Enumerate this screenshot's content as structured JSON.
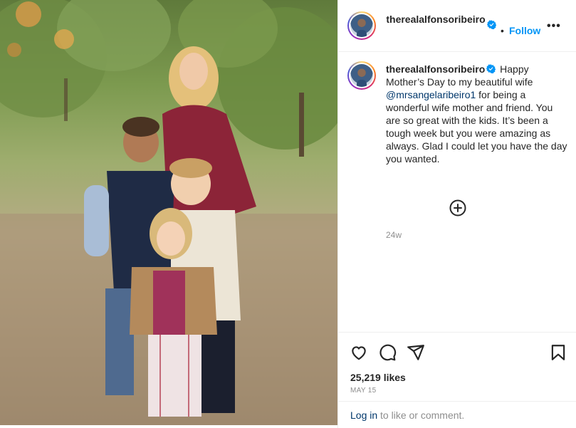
{
  "post": {
    "username": "therealalfonsoribeiro",
    "follow_label": "Follow",
    "separator": "•",
    "more_label": "•••",
    "caption_user": "therealalfonsoribeiro",
    "caption_part1": " Happy Mother’s Day to my beautiful wife ",
    "caption_mention": "@mrsangelaribeiro1",
    "caption_part2": " for being a wonderful wife mother and friend. You are so great with the kids. It’s been a tough week but you were amazing as always. Glad I could let you have the day you wanted.",
    "time_ago": "24w",
    "likes": "25,219 likes",
    "date": "MAY 15",
    "login_link": "Log in",
    "login_rest": " to like or comment."
  },
  "icons": {
    "verified": "verified-badge-icon",
    "add_comment": "plus-circle-icon",
    "like": "heart-icon",
    "comment": "speech-bubble-icon",
    "share": "paper-plane-icon",
    "save": "bookmark-icon"
  },
  "colors": {
    "accent": "#0095f6",
    "mention": "#00376b",
    "muted": "#8e8e8e",
    "text": "#262626"
  }
}
